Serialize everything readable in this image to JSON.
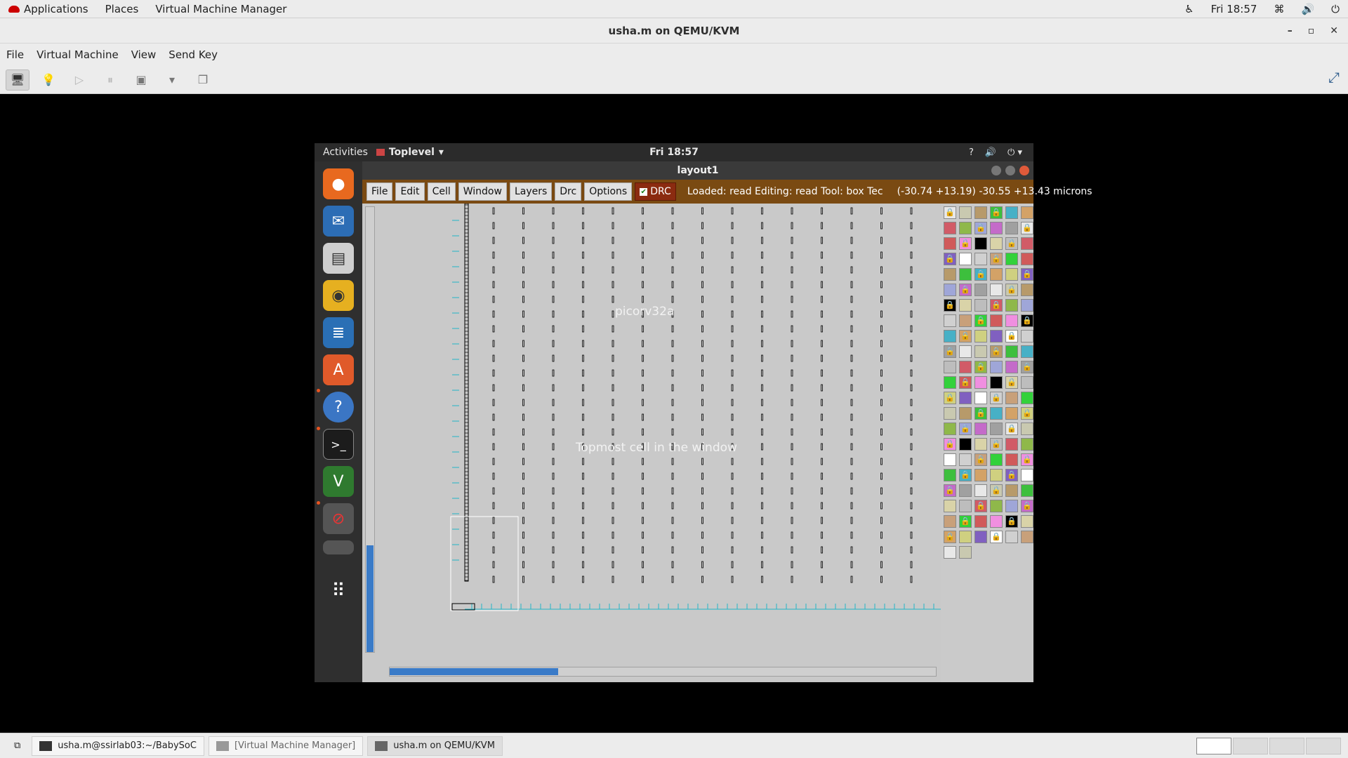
{
  "host_panel": {
    "applications": "Applications",
    "places": "Places",
    "vmm": "Virtual Machine Manager",
    "clock": "Fri 18:57"
  },
  "vm_window": {
    "title": "usha.m on QEMU/KVM",
    "menu": [
      "File",
      "Virtual Machine",
      "View",
      "Send Key"
    ]
  },
  "guest": {
    "activities": "Activities",
    "toplevel": "Toplevel",
    "clock": "Fri 18:57",
    "window_title": "layout1",
    "menu": [
      "File",
      "Edit",
      "Cell",
      "Window",
      "Layers",
      "Drc",
      "Options"
    ],
    "drc_label": "DRC",
    "status": "Loaded: read Editing: read Tool: box  Tec",
    "coords": "(-30.74 +13.19) -30.55 +13.43 microns",
    "cell_name": "picorv32a",
    "cell_caption": "Topmost cell in the window"
  },
  "taskbar": {
    "tasks": [
      "usha.m@ssirlab03:~/BabySoC",
      "[Virtual Machine Manager]",
      "usha.m on QEMU/KVM"
    ]
  }
}
